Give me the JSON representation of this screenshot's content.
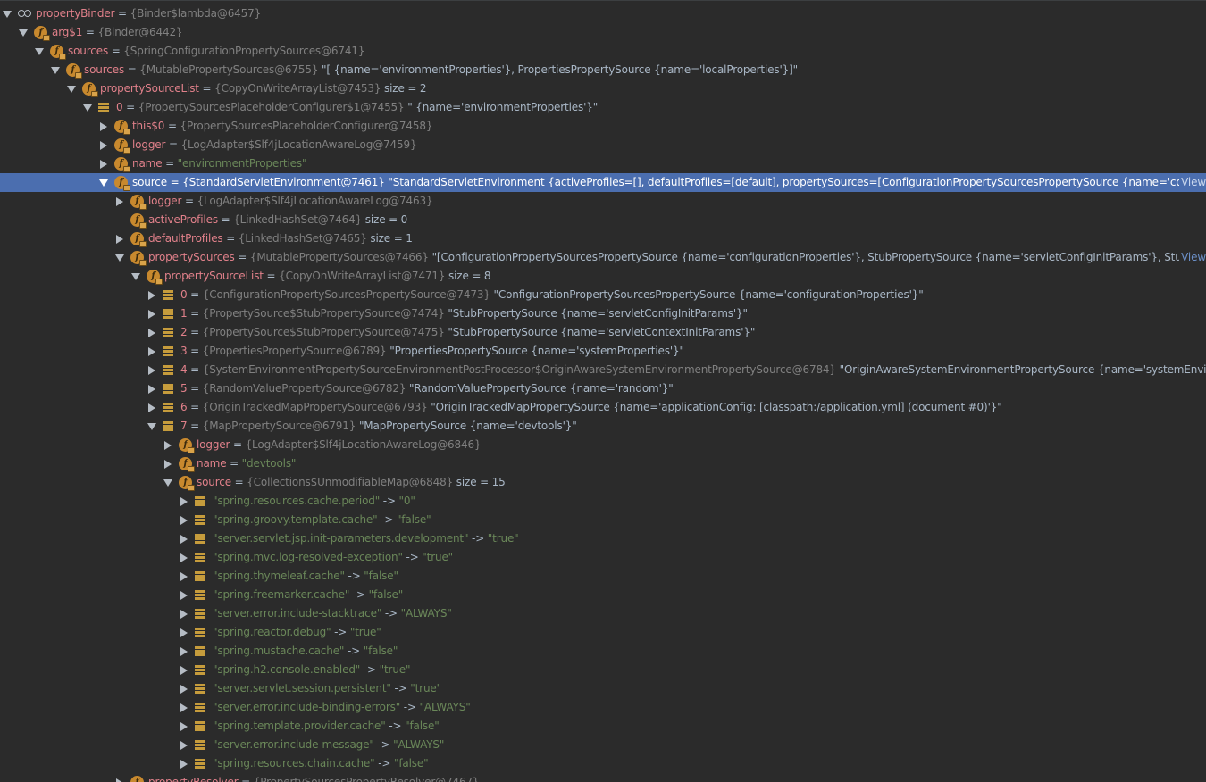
{
  "colors": {
    "background": "#2b2b2b",
    "selection": "#4b6eaf",
    "field_name": "#e0808a",
    "type_text": "#808080",
    "string_value": "#6a8759",
    "value_text": "#a9b7c6",
    "field_icon": "#c8892e",
    "link": "#6b8fc7"
  },
  "rows": [
    {
      "depth": 0,
      "expander": "expanded",
      "icon": "watch-icon",
      "name": "propertyBinder",
      "type": "{Binder$lambda@6457}",
      "value": ""
    },
    {
      "depth": 1,
      "expander": "expanded",
      "icon": "field-icon",
      "name": "arg$1",
      "type": "{Binder@6442}",
      "value": ""
    },
    {
      "depth": 2,
      "expander": "expanded",
      "icon": "field-icon",
      "name": "sources",
      "type": "{SpringConfigurationPropertySources@6741}",
      "value": ""
    },
    {
      "depth": 3,
      "expander": "expanded",
      "icon": "field-icon",
      "name": "sources",
      "type": "{MutablePropertySources@6755}",
      "value": "\"[ {name='environmentProperties'}, PropertiesPropertySource {name='localProperties'}]\""
    },
    {
      "depth": 4,
      "expander": "expanded",
      "icon": "field-icon",
      "name": "propertySourceList",
      "type": "{CopyOnWriteArrayList@7453}",
      "value": " size = 2"
    },
    {
      "depth": 5,
      "expander": "expanded",
      "icon": "array-icon",
      "name": "0",
      "type": "{PropertySourcesPlaceholderConfigurer$1@7455}",
      "value": "\" {name='environmentProperties'}\""
    },
    {
      "depth": 6,
      "expander": "collapsed",
      "icon": "field-icon",
      "name": "this$0",
      "type": "{PropertySourcesPlaceholderConfigurer@7458}",
      "value": ""
    },
    {
      "depth": 6,
      "expander": "collapsed",
      "icon": "field-icon",
      "name": "logger",
      "type": "{LogAdapter$Slf4jLocationAwareLog@7459}",
      "value": ""
    },
    {
      "depth": 6,
      "expander": "collapsed",
      "icon": "field-icon",
      "name": "name",
      "type": "",
      "value": "\"environmentProperties\"",
      "string": true
    },
    {
      "depth": 6,
      "expander": "expanded",
      "icon": "field-icon",
      "name": "source",
      "type": "{StandardServletEnvironment@7461}",
      "value": "\"StandardServletEnvironment {activeProfiles=[], defaultProfiles=[default], propertySources=[ConfigurationPropertySourcesPropertySource {name='configurationProperties...",
      "view": "View",
      "selected": true
    },
    {
      "depth": 7,
      "expander": "collapsed",
      "icon": "field-icon",
      "name": "logger",
      "type": "{LogAdapter$Slf4jLocationAwareLog@7463}",
      "value": ""
    },
    {
      "depth": 7,
      "expander": "none",
      "icon": "field-icon",
      "name": "activeProfiles",
      "type": "{LinkedHashSet@7464}",
      "value": " size = 0"
    },
    {
      "depth": 7,
      "expander": "collapsed",
      "icon": "field-icon",
      "name": "defaultProfiles",
      "type": "{LinkedHashSet@7465}",
      "value": " size = 1"
    },
    {
      "depth": 7,
      "expander": "expanded",
      "icon": "field-icon",
      "name": "propertySources",
      "type": "{MutablePropertySources@7466}",
      "value": "\"[ConfigurationPropertySourcesPropertySource {name='configurationProperties'}, StubPropertySource {name='servletConfigInitParams'}, StubPropertySource {na...",
      "view": "View"
    },
    {
      "depth": 8,
      "expander": "expanded",
      "icon": "field-icon",
      "name": "propertySourceList",
      "type": "{CopyOnWriteArrayList@7471}",
      "value": " size = 8"
    },
    {
      "depth": 9,
      "expander": "collapsed",
      "icon": "array-icon",
      "name": "0",
      "type": "{ConfigurationPropertySourcesPropertySource@7473}",
      "value": "\"ConfigurationPropertySourcesPropertySource {name='configurationProperties'}\""
    },
    {
      "depth": 9,
      "expander": "collapsed",
      "icon": "array-icon",
      "name": "1",
      "type": "{PropertySource$StubPropertySource@7474}",
      "value": "\"StubPropertySource {name='servletConfigInitParams'}\""
    },
    {
      "depth": 9,
      "expander": "collapsed",
      "icon": "array-icon",
      "name": "2",
      "type": "{PropertySource$StubPropertySource@7475}",
      "value": "\"StubPropertySource {name='servletContextInitParams'}\""
    },
    {
      "depth": 9,
      "expander": "collapsed",
      "icon": "array-icon",
      "name": "3",
      "type": "{PropertiesPropertySource@6789}",
      "value": "\"PropertiesPropertySource {name='systemProperties'}\""
    },
    {
      "depth": 9,
      "expander": "collapsed",
      "icon": "array-icon",
      "name": "4",
      "type": "{SystemEnvironmentPropertySourceEnvironmentPostProcessor$OriginAwareSystemEnvironmentPropertySource@6784}",
      "value": "\"OriginAwareSystemEnvironmentPropertySource {name='systemEnvironment'}\""
    },
    {
      "depth": 9,
      "expander": "collapsed",
      "icon": "array-icon",
      "name": "5",
      "type": "{RandomValuePropertySource@6782}",
      "value": "\"RandomValuePropertySource {name='random'}\""
    },
    {
      "depth": 9,
      "expander": "collapsed",
      "icon": "array-icon",
      "name": "6",
      "type": "{OriginTrackedMapPropertySource@6793}",
      "value": "\"OriginTrackedMapPropertySource {name='applicationConfig: [classpath:/application.yml] (document #0)'}\""
    },
    {
      "depth": 9,
      "expander": "expanded",
      "icon": "array-icon",
      "name": "7",
      "type": "{MapPropertySource@6791}",
      "value": "\"MapPropertySource {name='devtools'}\""
    },
    {
      "depth": 10,
      "expander": "collapsed",
      "icon": "field-icon",
      "name": "logger",
      "type": "{LogAdapter$Slf4jLocationAwareLog@6846}",
      "value": ""
    },
    {
      "depth": 10,
      "expander": "collapsed",
      "icon": "field-icon",
      "name": "name",
      "type": "",
      "value": "\"devtools\"",
      "string": true
    },
    {
      "depth": 10,
      "expander": "expanded",
      "icon": "field-icon",
      "name": "source",
      "type": "{Collections$UnmodifiableMap@6848}",
      "value": " size = 15"
    },
    {
      "depth": 11,
      "expander": "collapsed",
      "icon": "array-icon",
      "entry": true,
      "name": "\"spring.resources.cache.period\"",
      "value": "\"0\""
    },
    {
      "depth": 11,
      "expander": "collapsed",
      "icon": "array-icon",
      "entry": true,
      "name": "\"spring.groovy.template.cache\"",
      "value": "\"false\""
    },
    {
      "depth": 11,
      "expander": "collapsed",
      "icon": "array-icon",
      "entry": true,
      "name": "\"server.servlet.jsp.init-parameters.development\"",
      "value": "\"true\""
    },
    {
      "depth": 11,
      "expander": "collapsed",
      "icon": "array-icon",
      "entry": true,
      "name": "\"spring.mvc.log-resolved-exception\"",
      "value": "\"true\""
    },
    {
      "depth": 11,
      "expander": "collapsed",
      "icon": "array-icon",
      "entry": true,
      "name": "\"spring.thymeleaf.cache\"",
      "value": "\"false\""
    },
    {
      "depth": 11,
      "expander": "collapsed",
      "icon": "array-icon",
      "entry": true,
      "name": "\"spring.freemarker.cache\"",
      "value": "\"false\""
    },
    {
      "depth": 11,
      "expander": "collapsed",
      "icon": "array-icon",
      "entry": true,
      "name": "\"server.error.include-stacktrace\"",
      "value": "\"ALWAYS\""
    },
    {
      "depth": 11,
      "expander": "collapsed",
      "icon": "array-icon",
      "entry": true,
      "name": "\"spring.reactor.debug\"",
      "value": "\"true\""
    },
    {
      "depth": 11,
      "expander": "collapsed",
      "icon": "array-icon",
      "entry": true,
      "name": "\"spring.mustache.cache\"",
      "value": "\"false\""
    },
    {
      "depth": 11,
      "expander": "collapsed",
      "icon": "array-icon",
      "entry": true,
      "name": "\"spring.h2.console.enabled\"",
      "value": "\"true\""
    },
    {
      "depth": 11,
      "expander": "collapsed",
      "icon": "array-icon",
      "entry": true,
      "name": "\"server.servlet.session.persistent\"",
      "value": "\"true\""
    },
    {
      "depth": 11,
      "expander": "collapsed",
      "icon": "array-icon",
      "entry": true,
      "name": "\"server.error.include-binding-errors\"",
      "value": "\"ALWAYS\""
    },
    {
      "depth": 11,
      "expander": "collapsed",
      "icon": "array-icon",
      "entry": true,
      "name": "\"spring.template.provider.cache\"",
      "value": "\"false\""
    },
    {
      "depth": 11,
      "expander": "collapsed",
      "icon": "array-icon",
      "entry": true,
      "name": "\"server.error.include-message\"",
      "value": "\"ALWAYS\""
    },
    {
      "depth": 11,
      "expander": "collapsed",
      "icon": "array-icon",
      "entry": true,
      "name": "\"spring.resources.chain.cache\"",
      "value": "\"false\""
    },
    {
      "depth": 7,
      "expander": "collapsed",
      "icon": "field-icon",
      "name": "propertyResolver",
      "type": "{PropertySourcesPropertyResolver@7467}",
      "value": ""
    }
  ]
}
